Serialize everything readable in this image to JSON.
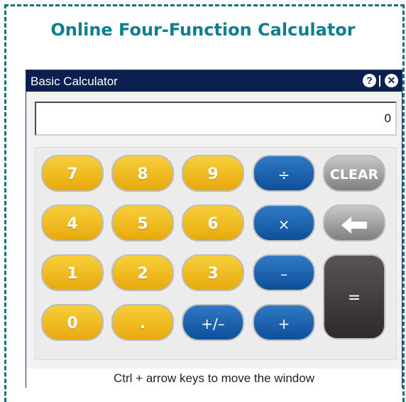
{
  "page": {
    "heading": "Online Four-Function Calculator"
  },
  "window": {
    "title": "Basic Calculator",
    "help_label": "?",
    "close_label": "✕",
    "display_value": "0",
    "hint": "Ctrl + arrow keys to move the window"
  },
  "keys": {
    "seven": "7",
    "eight": "8",
    "nine": "9",
    "divide": "÷",
    "clear": "CLEAR",
    "four": "4",
    "five": "5",
    "six": "6",
    "multiply": "×",
    "one": "1",
    "two": "2",
    "three": "3",
    "minus": "–",
    "zero": "0",
    "decimal": ".",
    "negate": "+/–",
    "plus": "+",
    "equals": "="
  },
  "icons": {
    "backspace": "left-arrow-icon"
  },
  "colors": {
    "heading": "#0f7f8f",
    "frame_dash": "#0f6f84",
    "titlebar": "#0c2050",
    "number_key": "#f0bb1e",
    "operator_key": "#1f64b0",
    "function_key": "#9a9a9a",
    "equals_key": "#3f3838"
  }
}
